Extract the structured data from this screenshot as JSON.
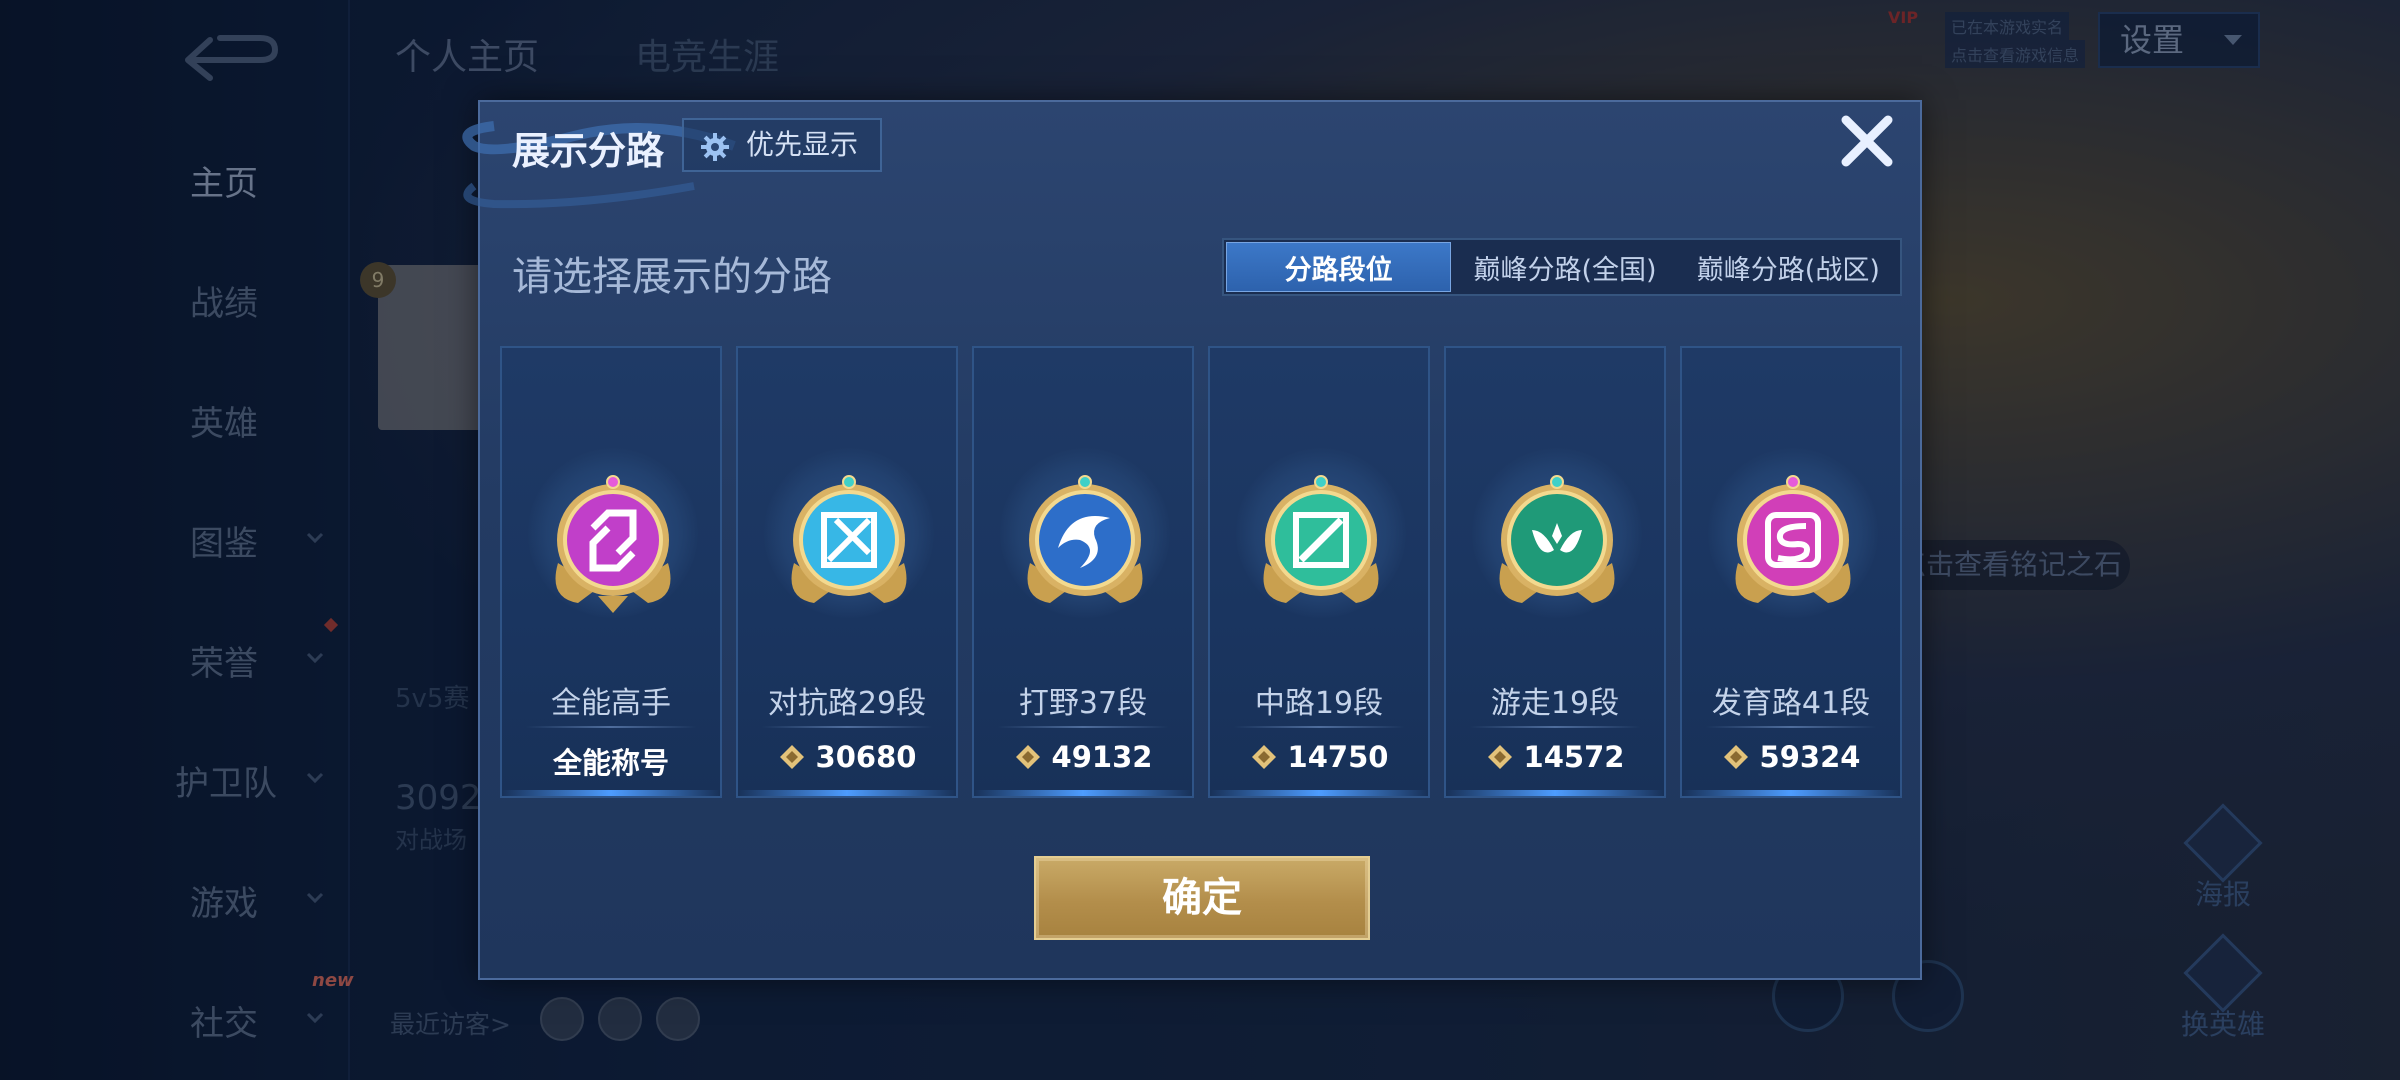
{
  "background": {
    "sidebar": {
      "items": [
        {
          "label": "主页",
          "has_chevron": false,
          "active": true
        },
        {
          "label": "战绩",
          "has_chevron": false
        },
        {
          "label": "英雄",
          "has_chevron": false
        },
        {
          "label": "图鉴",
          "has_chevron": true
        },
        {
          "label": "荣誉",
          "has_chevron": true
        },
        {
          "label": "护卫队",
          "has_chevron": true
        },
        {
          "label": "游戏",
          "has_chevron": true
        },
        {
          "label": "社交",
          "has_chevron": true
        }
      ],
      "new_badge": "new"
    },
    "tabs": [
      "个人主页",
      "电竞生涯"
    ],
    "level": "9",
    "mode_text": "5v5赛",
    "score": "3092",
    "score_caption": "对战场",
    "recent_visitors": "最近访客>",
    "rune_hint": "点击查看铭记之石",
    "vip": "VIP",
    "vip_line1": "已在本游戏实名",
    "vip_line2": "点击查看游戏信息",
    "settings": "设置",
    "poster": "海报",
    "change_hero": "换英雄"
  },
  "modal": {
    "title": "展示分路",
    "priority_label": "优先显示",
    "subtitle": "请选择展示的分路",
    "segments": [
      {
        "label": "分路段位",
        "active": true
      },
      {
        "label": "巅峰分路(全国)",
        "active": false
      },
      {
        "label": "巅峰分路(战区)",
        "active": false
      }
    ],
    "cards": [
      {
        "label": "全能高手",
        "value": "全能称号",
        "icon": "all-round-badge",
        "color": "#c13fc9",
        "show_points": false
      },
      {
        "label": "对抗路29段",
        "value": "30680",
        "icon": "clash-lane-badge",
        "color": "#37b7e6",
        "show_points": true
      },
      {
        "label": "打野37段",
        "value": "49132",
        "icon": "jungle-badge",
        "color": "#2d6ec9",
        "show_points": true
      },
      {
        "label": "中路19段",
        "value": "14750",
        "icon": "mid-lane-badge",
        "color": "#2fbe9b",
        "show_points": true
      },
      {
        "label": "游走19段",
        "value": "14572",
        "icon": "roam-badge",
        "color": "#1f9a78",
        "show_points": true
      },
      {
        "label": "发育路41段",
        "value": "59324",
        "icon": "farm-lane-badge",
        "color": "#d13fb8",
        "show_points": true
      }
    ],
    "confirm": "确定"
  },
  "colors": {
    "accent_blue": "#2d62ad",
    "gold": "#b38e4b"
  }
}
